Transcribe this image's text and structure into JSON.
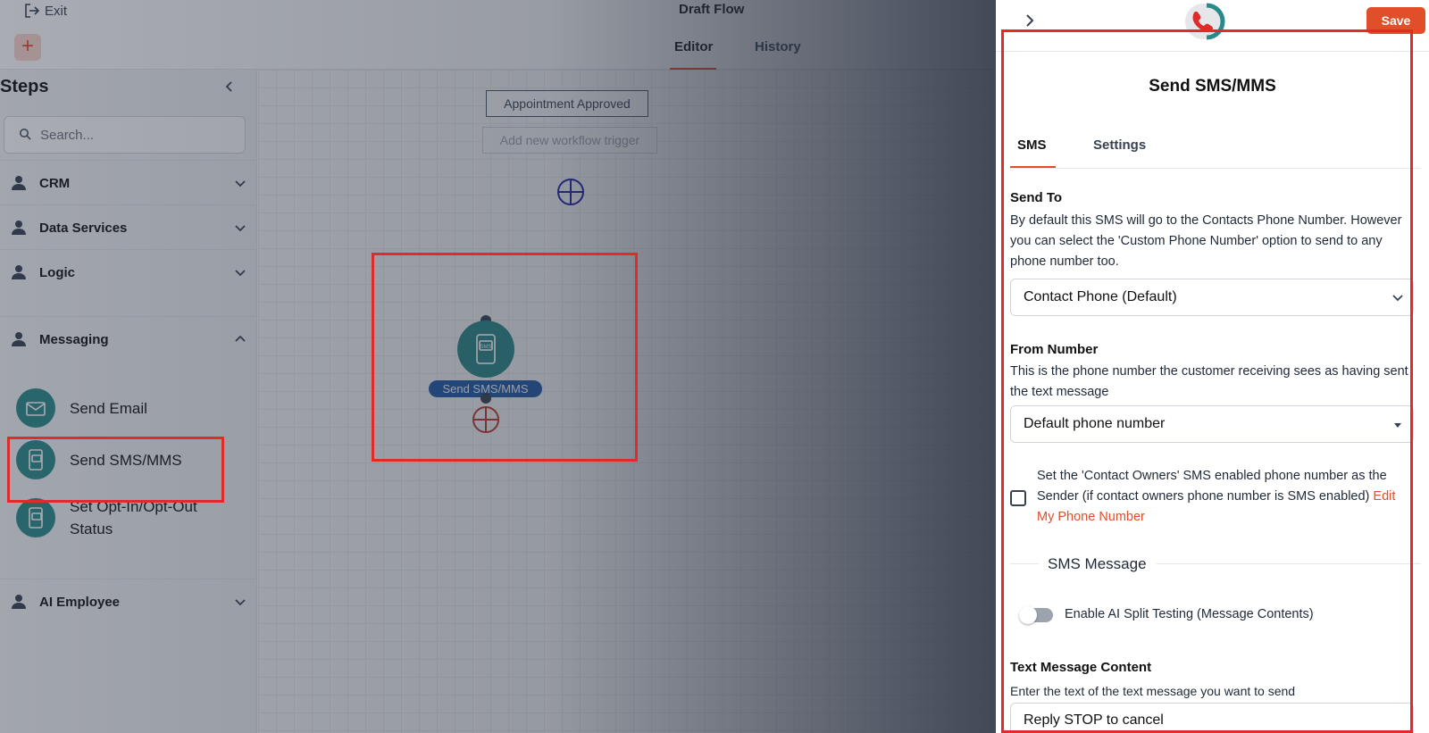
{
  "header": {
    "exit_label": "Exit",
    "flow_title": "Draft Flow",
    "add_label": "+",
    "tabs": [
      {
        "label": "Editor",
        "active": true
      },
      {
        "label": "History",
        "active": false
      }
    ]
  },
  "sidebar": {
    "title": "Steps",
    "search_placeholder": "Search...",
    "categories": [
      {
        "label": "CRM",
        "expanded": false
      },
      {
        "label": "Data Services",
        "expanded": false
      },
      {
        "label": "Logic",
        "expanded": false
      },
      {
        "label": "Messaging",
        "expanded": true
      },
      {
        "label": "AI Employee",
        "expanded": false
      }
    ],
    "messaging_items": [
      {
        "label": "Send Email",
        "icon": "email-icon"
      },
      {
        "label": "Send SMS/MMS",
        "icon": "sms-icon"
      },
      {
        "label": "Set Opt-In/Opt-Out Status",
        "icon": "sms-icon"
      }
    ]
  },
  "canvas": {
    "trigger_label": "Appointment Approved",
    "add_trigger_label": "Add new workflow trigger",
    "node_label": "Send SMS/MMS",
    "node_icon_text": "SMS"
  },
  "panel": {
    "save_label": "Save",
    "title": "Send SMS/MMS",
    "tabs": [
      {
        "label": "SMS",
        "active": true
      },
      {
        "label": "Settings",
        "active": false
      }
    ],
    "send_to": {
      "title": "Send To",
      "description": "By default this SMS will go to the Contacts Phone Number. However you can select the 'Custom Phone Number' option to send to any phone number too.",
      "value": "Contact Phone (Default)"
    },
    "from_number": {
      "title": "From Number",
      "description": "This is the phone number the customer receiving sees as having sent the text message",
      "value": "Default phone number"
    },
    "owner_checkbox": {
      "checked": false,
      "text": "Set the 'Contact Owners' SMS enabled phone number as the Sender (if contact owners phone number is SMS enabled)",
      "link": "Edit My Phone Number"
    },
    "sms_message_label": "SMS Message",
    "ai_split": {
      "enabled": false,
      "label": "Enable AI Split Testing (Message Contents)"
    },
    "text_content": {
      "title": "Text Message Content",
      "description": "Enter the text of the text message you want to send",
      "value": "Reply STOP to cancel"
    }
  },
  "colors": {
    "accent": "#e04e2a",
    "teal": "#2a8a8a",
    "node_label_bg": "#1e5aa8",
    "highlight": "#e12a2a"
  }
}
